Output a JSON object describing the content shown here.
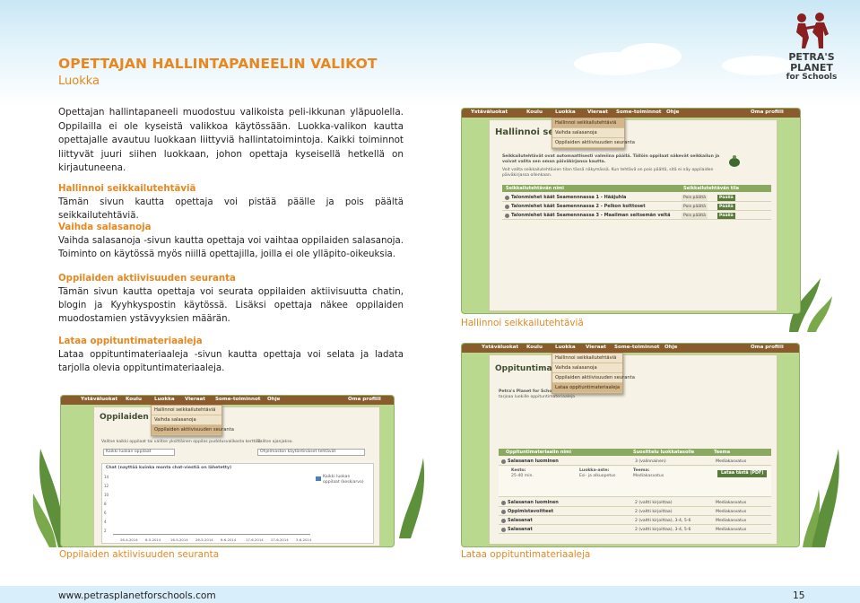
{
  "logo": {
    "line1": "PETRA'S",
    "line2": "PLANET",
    "line3": "for Schools"
  },
  "title": "OPETTAJAN HALLINTAPANEELIN VALIKOT",
  "subtitle": "Luokka",
  "intro": "Opettajan hallintapaneeli muodostuu valikoista peli-ikkunan yläpuolella. Oppilailla ei ole kyseistä valikkoa käytössään. Luokka-valikon kautta opettajalle avautuu luokkaan liittyviä hallintatoimintoja. Kaikki toiminnot liittyvät juuri siihen luokkaan, johon opettaja kyseisellä hetkellä on kirjautuneena.",
  "sections": [
    {
      "heading": "Hallinnoi seikkailutehtäviä",
      "body": "Tämän sivun kautta opettaja voi pistää päälle ja pois päältä seikkailutehtäviä."
    },
    {
      "heading": "Vaihda salasanoja",
      "body": "Vaihda salasanoja -sivun kautta opettaja voi vaihtaa oppilaiden salasanoja. Toiminto on käytössä myös niillä opettajilla, joilla ei ole ylläpito-oikeuksia."
    },
    {
      "heading": "Oppilaiden aktiivisuuden seuranta",
      "body": "Tämän sivun kautta opettaja voi seurata oppilaiden aktiivisuutta chatin, blogin ja Kyyhkyspostin käytössä. Lisäksi opettaja näkee oppilaiden muodostamien ystävyyksien määrän."
    },
    {
      "heading": "Lataa oppituntimateriaaleja",
      "body": "Lataa oppituntimateriaaleja -sivun kautta opettaja voi selata ja ladata tarjolla olevia oppituntimateriaaleja."
    }
  ],
  "nav": [
    "Ystäväluokat",
    "Koulu",
    "Luokka",
    "Vieraat",
    "Some-toiminnot",
    "Ohje",
    "Oma profiili"
  ],
  "nav2": [
    "Ystäväluokat",
    "Koulu",
    "Luokka",
    "Vieraat",
    "Some-toiminnot",
    "Ohje",
    "Oma profiili"
  ],
  "dropdown": [
    "Hallinnoi seikkailutehtäviä",
    "Vaihda salasanoja",
    "Oppilaiden aktiivisuuden seuranta",
    "Lataa oppituntimateriaaleja"
  ],
  "shot1": {
    "title": "Hallinnoi seikkailute",
    "note1": "Seikkailutehtävät ovat automaattisesti valmiina päällä. Tällöin oppilaat näkevät seikkailun ja",
    "note1b": "voivat valita sen oman päiväkirjansa kautta.",
    "note2": "Voit valita seikkailutehtävien tilan tässä näkymässä. Kun tehtävä on pois päältä, sitä ei näy oppilaiden",
    "note2b": "päiväkirjassa ollenkaan.",
    "col_name": "Seikkailutehtävän nimi",
    "col_state": "Seikkailutehtävän tila",
    "rows": [
      {
        "name": "Talonmiehet käät Seamennnassa 1 - Hääjuhla",
        "off": "Pois päältä",
        "on": "Päällä"
      },
      {
        "name": "Talonmiehet käät Seamennnassa 2 - Pelkon kolttoset",
        "off": "Pois päältä",
        "on": "Päällä"
      },
      {
        "name": "Talonmiehet käät Seamennnassa 3 - Maailman seitsemän veltä",
        "off": "Pois päältä",
        "on": "Päällä"
      }
    ]
  },
  "caption1": "Hallinnoi seikkailutehtäviä",
  "shot2": {
    "title": "Oppilaiden aktiivisuuden",
    "left_label": "Valitse kaikki oppilaat tai valitse yksittäinen oppilas pudotusvalikosta kerttää.",
    "left_select": "Kaikki luokan oppilaat",
    "right_label": "Valitse ajanjakso.",
    "right_select": "Ohjelmaston käytöntinäiset tehtävät",
    "chart_title": "Chat (nayttää kuinka monta chat-viestiä on lähetetty)",
    "legend1": "Kaikki luokan",
    "legend2": "oppilaat (keskiarvo)",
    "yticks": [
      "14",
      "12",
      "10",
      "8",
      "6",
      "4",
      "2"
    ],
    "xticks": [
      "26-4-2014",
      "6-5-2014",
      "16-5-2014",
      "26-5-2014",
      "6-6-2014",
      "17-6-2014",
      "27-6-2014",
      "3-6-2014"
    ]
  },
  "caption2": "Oppilaiden aktiivisuuden seuranta",
  "shot3": {
    "title": "Oppituntimateriaa",
    "intro1": "Petra's Planet for Schools",
    "intro2": "tarjoaa luokille oppituntimateriaaleja",
    "col1": "Oppituntimateriaalin nimi",
    "col2": "Suosittelu luokkatasolle",
    "col3": "Teema",
    "rows": [
      {
        "name": "Salasanan luominen",
        "grade": "3 (valinnainen)",
        "theme": "Mediakasvatus"
      },
      {
        "name": "Salasanan luominen",
        "grade": "2 (valtti kirjoittaa)",
        "theme": "Mediakasvatus"
      },
      {
        "name": "Oppimistavoitteet",
        "grade": "2 (valtti kirjoittaa)",
        "theme": "Mediakasvatus"
      },
      {
        "name": "Salasanat",
        "grade": "2 (valtti kirjoittaa), 3-4, 5-6",
        "theme": "Mediakasvatus"
      },
      {
        "name": "Salasanat",
        "grade": "2 (valtti kirjoittaa), 3-4, 5-6",
        "theme": "Mediakasvatus"
      }
    ],
    "detail_keys": [
      "Kesto:",
      "Luokka-aste:",
      "Teema:"
    ],
    "detail_vals": [
      "25-40 min.",
      "Esi- ja alkuopetus",
      "Mediakasvatus"
    ],
    "button": "Lataa tästä (PDF)"
  },
  "caption3": "Lataa oppituntimateriaaleja",
  "footer": {
    "url": "www.petrasplanetforschools.com",
    "page": "15"
  }
}
